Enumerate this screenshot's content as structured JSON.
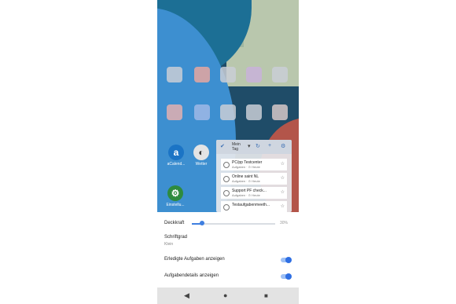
{
  "home_icons": [
    {
      "name": "aCalendar",
      "label": "aCalend...",
      "glyph": "a",
      "color": "#1b74c5"
    },
    {
      "name": "wetter",
      "label": "Wetter",
      "glyph": "◐",
      "color": "#e4e4e4"
    },
    {
      "name": "einstellungen",
      "label": "Einstellu...",
      "glyph": "⚙",
      "color": "#2e8b3e"
    }
  ],
  "widget": {
    "title_line1": "Mein",
    "title_line2": "Tag",
    "tasks": [
      {
        "title": "PC/pp Testcenter",
        "sub": "Aufgaben · ⊙ Heute"
      },
      {
        "title": "Online saint NL",
        "sub": "Aufgaben · ⊙ Heute"
      },
      {
        "title": "Support PF check...",
        "sub": "Aufgaben · ⊙ Heute"
      },
      {
        "title": "Testaufgabenmeeth...",
        "sub": ""
      }
    ]
  },
  "settings": {
    "opacity_label": "Deckkraft",
    "opacity_value": 0.12,
    "opacity_pct": "30%",
    "font_label": "Schriftgrad",
    "font_value": "Klein",
    "show_done_label": "Erledigte Aufgaben anzeigen",
    "show_done": true,
    "show_details_label": "Aufgabendetails anzeigen",
    "show_details": true
  },
  "navbar": {
    "back": "◀",
    "home": "●",
    "recents": "■"
  }
}
